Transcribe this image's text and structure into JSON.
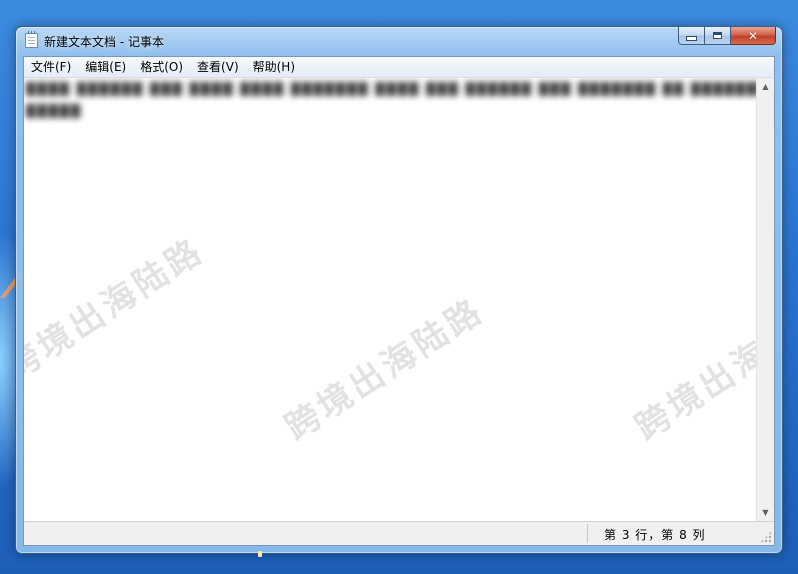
{
  "window": {
    "title": "新建文本文档 - 记事本",
    "controls": {
      "minimize": "—",
      "maximize": "□",
      "close": "✕"
    }
  },
  "menu": [
    {
      "label": "文件(F)"
    },
    {
      "label": "编辑(E)"
    },
    {
      "label": "格式(O)"
    },
    {
      "label": "查看(V)"
    },
    {
      "label": "帮助(H)"
    }
  ],
  "editor": {
    "line1": "████ ██████ ███ ████ ████ ███████ ████ ███ ██████ ███ ███████ ██ ████████",
    "line2": "█████"
  },
  "watermark": {
    "text": "跨境出海陆路"
  },
  "status": {
    "position": "第 3 行，第 8 列"
  },
  "icons": [
    "notepad-icon",
    "minimize-icon",
    "maximize-icon",
    "close-icon",
    "scroll-up-icon",
    "scroll-down-icon",
    "size-grip-icon"
  ]
}
